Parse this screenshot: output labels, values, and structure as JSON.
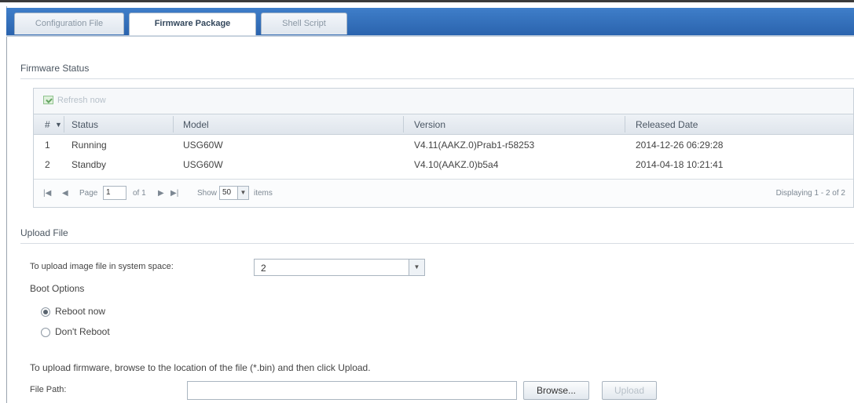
{
  "tabs": [
    {
      "label": "Configuration File"
    },
    {
      "label": "Firmware Package"
    },
    {
      "label": "Shell Script"
    }
  ],
  "firmware_status": {
    "title": "Firmware Status",
    "refresh_label": "Refresh now",
    "columns": [
      "#",
      "Status",
      "Model",
      "Version",
      "Released Date"
    ],
    "rows": [
      [
        "1",
        "Running",
        "USG60W",
        "V4.11(AAKZ.0)Prab1-r58253",
        "2014-12-26 06:29:28"
      ],
      [
        "2",
        "Standby",
        "USG60W",
        "V4.10(AAKZ.0)b5a4",
        "2014-04-18 10:21:41"
      ]
    ],
    "pager": {
      "page_label": "Page",
      "page_value": "1",
      "of_label": "of 1",
      "show_label": "Show",
      "show_value": "50",
      "items_label": "items",
      "displaying": "Displaying 1 - 2 of 2"
    }
  },
  "upload_file": {
    "title": "Upload File",
    "space_label": "To upload image file in system space:",
    "space_value": "2",
    "boot_options_label": "Boot Options",
    "reboot_now": "Reboot now",
    "dont_reboot": "Don't Reboot",
    "reboot_selected": "reboot_now",
    "instruction": "To upload firmware, browse to the location of the file (*.bin) and then click Upload.",
    "file_path_label": "File Path:",
    "file_path_value": "",
    "browse_label": "Browse...",
    "upload_label": "Upload"
  },
  "colors": {
    "tabbar": "#2f6fbf",
    "header_bg": "#e6ebf0",
    "disabled_text": "#b0b8c0"
  }
}
